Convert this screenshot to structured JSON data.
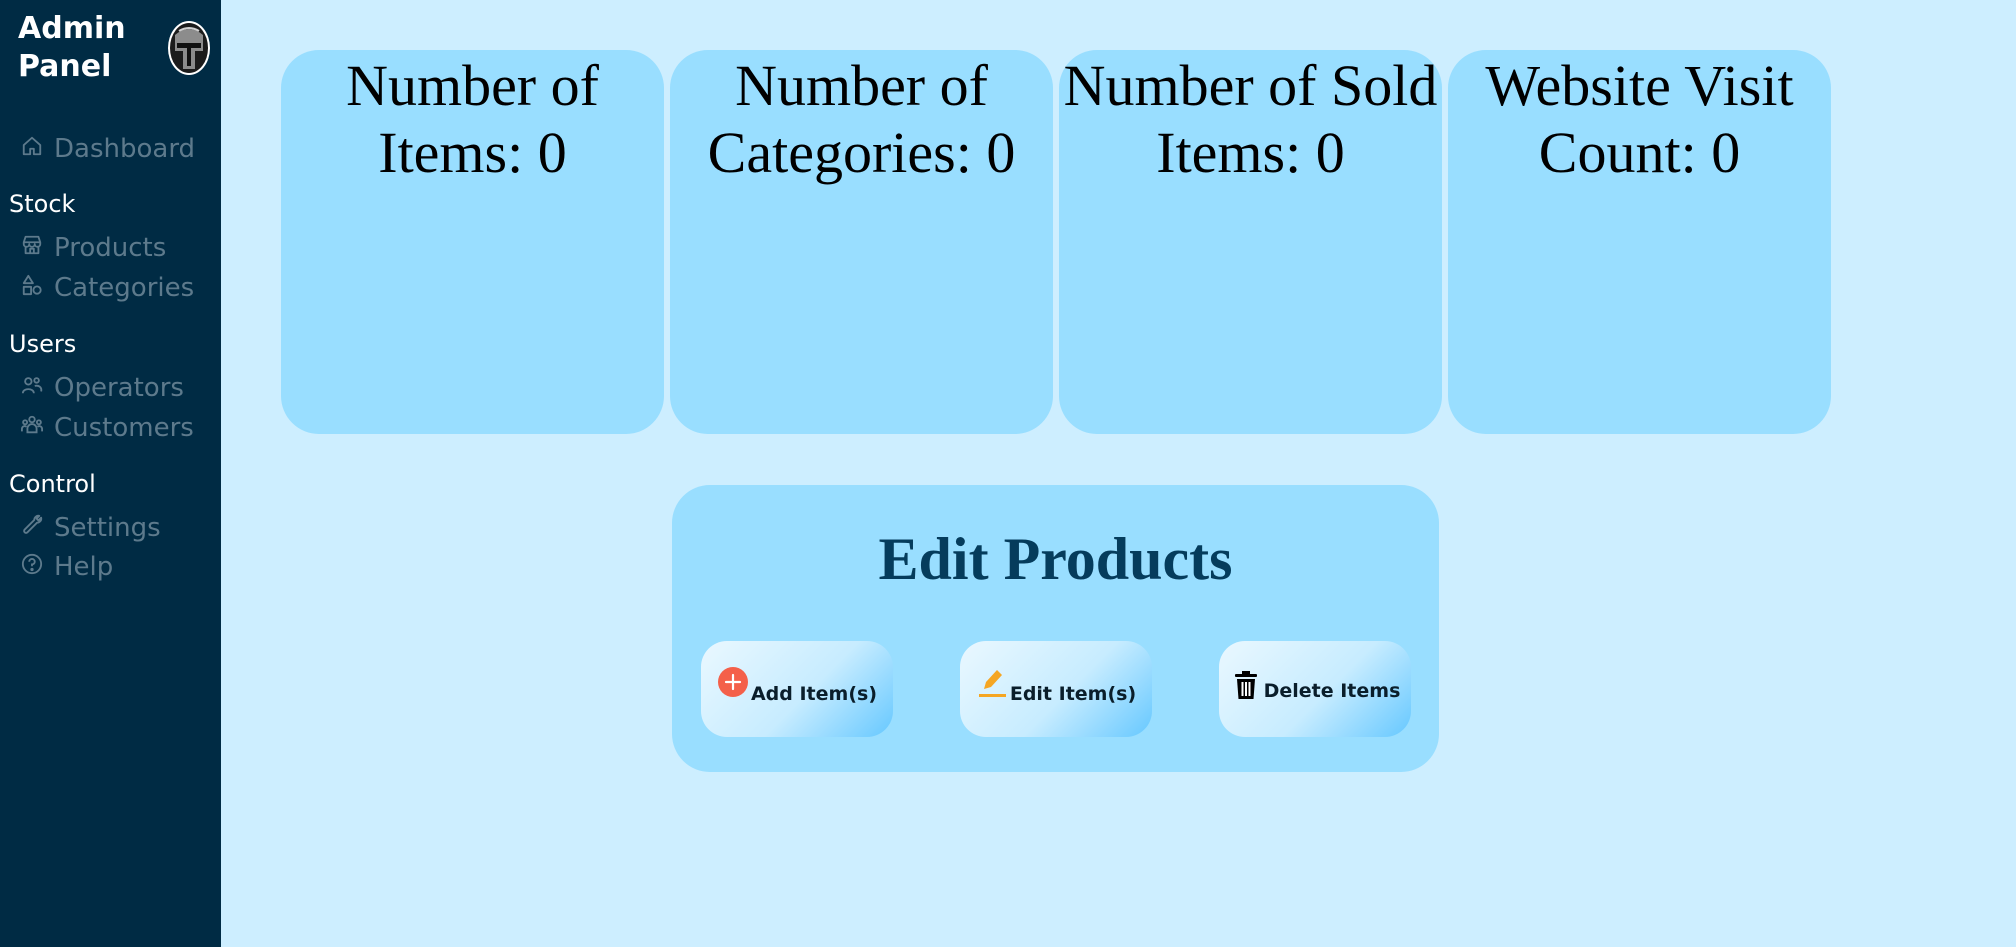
{
  "sidebar": {
    "brand_line1": "Admin",
    "brand_line2": "Panel",
    "nav": {
      "dashboard": "Dashboard",
      "section_stock": "Stock",
      "products": "Products",
      "categories": "Categories",
      "section_users": "Users",
      "operators": "Operators",
      "customers": "Customers",
      "section_control": "Control",
      "settings": "Settings",
      "help": "Help"
    }
  },
  "stats": {
    "items_line1": "Number of",
    "items_line2": "Items: 0",
    "categories_line1": "Number of",
    "categories_line2": "Categories: 0",
    "sold_line1": "Number of Sold",
    "sold_line2": "Items: 0",
    "visits_line1": "Website Visit",
    "visits_line2": "Count: 0"
  },
  "edit_products": {
    "title": "Edit Products",
    "add_label": "Add Item(s)",
    "edit_label": "Edit Item(s)",
    "delete_label": "Delete Items"
  },
  "colors": {
    "sidebar_bg": "#002b44",
    "page_bg": "#cdeeff",
    "card_bg": "#99deff",
    "nav_text": "#5d7a8c",
    "title_color": "#053c5c",
    "add_icon": "#f4604a",
    "edit_icon": "#f5a623"
  },
  "icons": {
    "dashboard": "home-icon",
    "products": "store-icon",
    "categories": "shapes-icon",
    "operators": "user-group-icon",
    "customers": "users-icon",
    "settings": "wrench-icon",
    "help": "question-circle-icon",
    "add": "plus-circle-icon",
    "edit": "pencil-icon",
    "delete": "trash-icon"
  }
}
